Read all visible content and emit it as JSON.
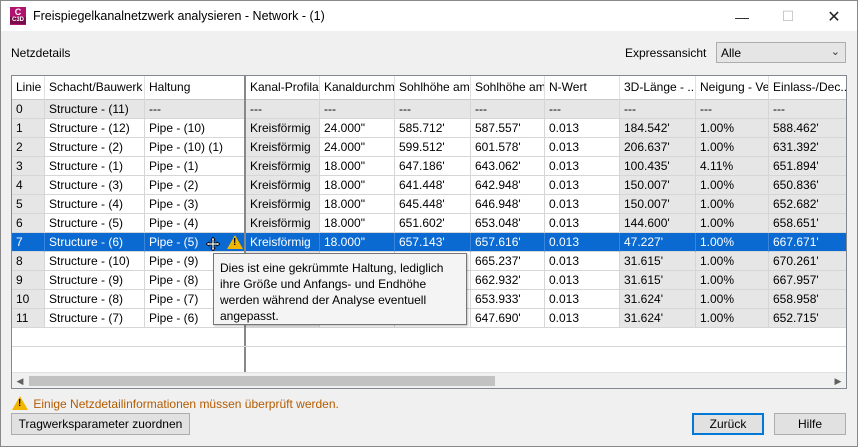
{
  "window": {
    "app_icon_letter": "C",
    "app_icon_sub": "C3D",
    "title": "Freispiegelkanalnetzwerk analysieren - Network - (1)",
    "minimize": "—",
    "maximize": "☐",
    "close": "✕"
  },
  "top": {
    "netzdetails_label": "Netzdetails",
    "expressansicht_label": "Expressansicht",
    "expressansicht_value": "Alle"
  },
  "grid": {
    "columns": [
      "Linie",
      "Schacht/Bauwerk",
      "Haltung",
      "Kanal-Profilart",
      "Kanaldurchm...",
      "Sohlhöhe am...",
      "Sohlhöhe am...",
      "N-Wert",
      "3D-Länge - ...",
      "Neigung - Ve...",
      "Einlass-/Dec..."
    ],
    "rows": [
      [
        "0",
        "Structure - (11)",
        "---",
        "---",
        "---",
        "---",
        "---",
        "---",
        "---",
        "---",
        "---"
      ],
      [
        "1",
        "Structure - (12)",
        "Pipe - (10)",
        "Kreisförmig",
        "24.000\"",
        "585.712'",
        "587.557'",
        "0.013",
        "184.542'",
        "1.00%",
        "588.462'"
      ],
      [
        "2",
        "Structure - (2)",
        "Pipe - (10) (1)",
        "Kreisförmig",
        "24.000\"",
        "599.512'",
        "601.578'",
        "0.013",
        "206.637'",
        "1.00%",
        "631.392'"
      ],
      [
        "3",
        "Structure - (1)",
        "Pipe - (1)",
        "Kreisförmig",
        "18.000\"",
        "647.186'",
        "643.062'",
        "0.013",
        "100.435'",
        "4.11%",
        "651.894'"
      ],
      [
        "4",
        "Structure - (3)",
        "Pipe - (2)",
        "Kreisförmig",
        "18.000\"",
        "641.448'",
        "642.948'",
        "0.013",
        "150.007'",
        "1.00%",
        "650.836'"
      ],
      [
        "5",
        "Structure - (4)",
        "Pipe - (3)",
        "Kreisförmig",
        "18.000\"",
        "645.448'",
        "646.948'",
        "0.013",
        "150.007'",
        "1.00%",
        "652.682'"
      ],
      [
        "6",
        "Structure - (5)",
        "Pipe - (4)",
        "Kreisförmig",
        "18.000\"",
        "651.602'",
        "653.048'",
        "0.013",
        "144.600'",
        "1.00%",
        "658.651'"
      ],
      [
        "7",
        "Structure - (6)",
        "Pipe - (5)",
        "Kreisförmig",
        "18.000\"",
        "657.143'",
        "657.616'",
        "0.013",
        "47.227'",
        "1.00%",
        "667.671'"
      ],
      [
        "8",
        "Structure - (10)",
        "Pipe - (9)",
        "",
        "",
        "",
        "665.237'",
        "0.013",
        "31.615'",
        "1.00%",
        "670.261'"
      ],
      [
        "9",
        "Structure - (9)",
        "Pipe - (8)",
        "",
        "",
        "",
        "662.932'",
        "0.013",
        "31.615'",
        "1.00%",
        "667.957'"
      ],
      [
        "10",
        "Structure - (8)",
        "Pipe - (7)",
        "",
        "",
        "",
        "653.933'",
        "0.013",
        "31.624'",
        "1.00%",
        "658.958'"
      ],
      [
        "11",
        "Structure - (7)",
        "Pipe - (6)",
        "",
        "",
        "",
        "647.690'",
        "0.013",
        "31.624'",
        "1.00%",
        "652.715'"
      ]
    ],
    "selected_row": 7
  },
  "tooltip": {
    "text": "Dies ist eine gekrümmte Haltung, lediglich ihre Größe und Anfangs- und Endhöhe werden während der Analyse eventuell angepasst."
  },
  "footer": {
    "warning_message": "Einige Netzdetailinformationen müssen überprüft werden.",
    "tragwerk_button": "Tragwerksparameter zuordnen",
    "zurueck_button": "Zurück",
    "hilfe_button": "Hilfe"
  },
  "colors": {
    "selection": "#0a6ad2",
    "warning_text": "#b35c00",
    "warning_icon": "#f2b600",
    "app_icon": "#b0136e"
  }
}
